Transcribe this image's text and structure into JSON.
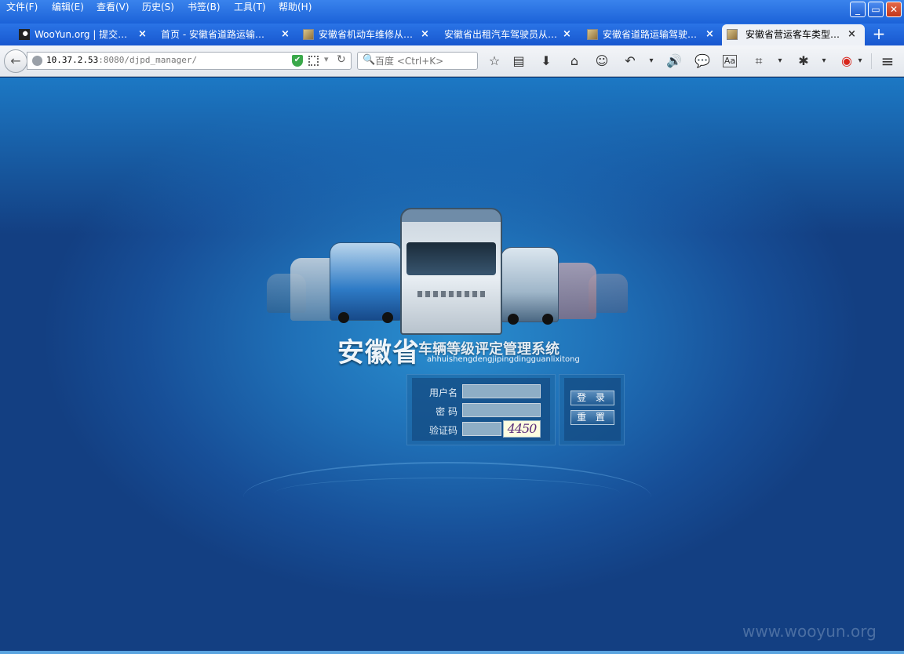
{
  "menubar": {
    "items": [
      "文件(F)",
      "编辑(E)",
      "查看(V)",
      "历史(S)",
      "书签(B)",
      "工具(T)",
      "帮助(H)"
    ],
    "minimize_glyph": "_",
    "restore_glyph": "▭",
    "close_glyph": "✕"
  },
  "tabs": [
    {
      "title": "WooYun.org | 提交…",
      "active": false
    },
    {
      "title": "首页 - 安徽省道路运输…",
      "active": false
    },
    {
      "title": "安徽省机动车维修从…",
      "active": false
    },
    {
      "title": "安徽省出租汽车驾驶员从…",
      "active": false
    },
    {
      "title": "安徽省道路运输驾驶…",
      "active": false
    },
    {
      "title": "安徽省营运客车类型…",
      "active": true
    }
  ],
  "tab_close_glyph": "×",
  "new_tab_glyph": "+",
  "navbar": {
    "url_host": "10.37.2.53",
    "url_rest": ":8080/djpd_manager/",
    "search_placeholder": "百度 <Ctrl+K>"
  },
  "icons": {
    "back": "←",
    "reload": "↻",
    "dropdown": "▾",
    "search": "🔍",
    "bookmark_star": "☆",
    "reading_list": "▤",
    "download": "⬇",
    "home": "⌂",
    "emoji": "☺",
    "undo": "↶",
    "volume": "🔊",
    "chat": "💬",
    "reader": "Aa",
    "crop": "⌗",
    "bug": "✱",
    "weibo": "◉",
    "menu": "≡",
    "shield": "✔"
  },
  "page": {
    "brand_main": "安徽省",
    "brand_sub": "车辆等级评定管理系统",
    "brand_pinyin": "ahhuishengdengjipingdingguanlixitong",
    "form": {
      "username_label": "用户名",
      "password_label": "密 码",
      "captcha_label": "验证码",
      "username_value": "",
      "password_value": "",
      "captcha_value": "",
      "captcha_image_text": "4450"
    },
    "buttons": {
      "login": "登 录",
      "reset": "重 置"
    }
  },
  "watermark": "www.wooyun.org",
  "colors": {
    "chrome_blue": "#1b62d8",
    "page_blue": "#174f98",
    "input_fill": "#8eaec6"
  }
}
